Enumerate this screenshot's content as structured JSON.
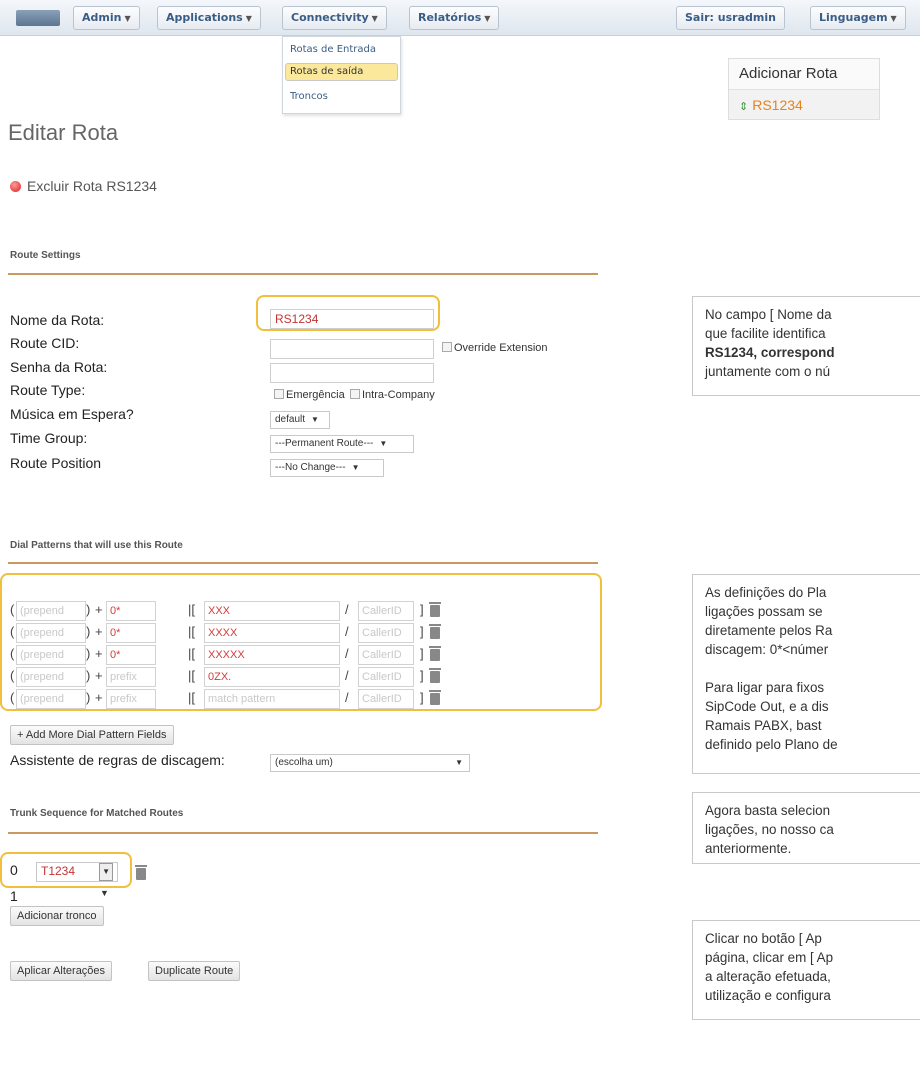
{
  "nav": {
    "menus": [
      "Admin",
      "Applications",
      "Connectivity",
      "Relatórios"
    ],
    "logout": "Sair: usradmin",
    "language": "Linguagem",
    "dropdown": [
      "Rotas de Entrada",
      "Rotas de saída",
      "Troncos"
    ]
  },
  "add_panel": {
    "title": "Adicionar Rota",
    "route": "RS1234"
  },
  "page": {
    "title": "Editar Rota",
    "delete_label": "Excluir Rota RS1234"
  },
  "route_settings": {
    "section": "Route Settings",
    "labels": [
      "Nome da Rota:",
      "Route CID:",
      "Senha da Rota:",
      "Route Type:",
      "Música em Espera?",
      "Time Group:",
      "Route Position"
    ],
    "route_name": "RS1234",
    "override_extension": "Override Extension",
    "type_emergency": "Emergência",
    "type_intra": "Intra-Company",
    "music": "default",
    "time_group": "---Permanent Route---",
    "position": "---No Change---"
  },
  "dial_patterns": {
    "section": "Dial Patterns that will use this Route",
    "prepend_placeholder": "(prepend",
    "callerid_placeholder": "CallerID",
    "rows": [
      {
        "prefix": "0*",
        "pattern": "XXX"
      },
      {
        "prefix": "0*",
        "pattern": "XXXX"
      },
      {
        "prefix": "0*",
        "pattern": "XXXXX"
      },
      {
        "prefix": "prefix",
        "pattern": "0ZX."
      },
      {
        "prefix": "prefix",
        "pattern": "match pattern"
      }
    ],
    "add_more": "+ Add More Dial Pattern Fields",
    "wizard_label": "Assistente de regras de discagem:",
    "wizard_value": "(escolha um)"
  },
  "trunks": {
    "section": "Trunk Sequence for Matched Routes",
    "rows": [
      {
        "index": "0",
        "trunk": "T1234"
      },
      {
        "index": "1",
        "trunk": ""
      }
    ],
    "add_button": "Adicionar tronco"
  },
  "actions": {
    "apply": "Aplicar Alterações",
    "duplicate": "Duplicate Route"
  },
  "notes": {
    "n1_lines": [
      "No campo [ Nome da",
      "que facilite identifica",
      "RS1234, correspond",
      "juntamente com o nú"
    ],
    "n2_lines": [
      "As definições do Pla",
      "ligações possam se",
      "diretamente pelos Ra",
      "discagem: 0*<númer",
      "",
      "Para ligar para fixos",
      "SipCode Out, e a dis",
      "Ramais PABX, bast",
      "definido pelo Plano de"
    ],
    "n3_lines": [
      "Agora basta selecion",
      "ligações, no nosso ca",
      "anteriormente."
    ],
    "n4_lines": [
      "Clicar no botão [ Ap",
      "página, clicar em [ Ap",
      "a alteração efetuada,",
      "utilização e configura"
    ]
  },
  "colors": {
    "accent": "#e8821e",
    "highlight": "#f1bf3b",
    "link": "#3b5d85"
  }
}
